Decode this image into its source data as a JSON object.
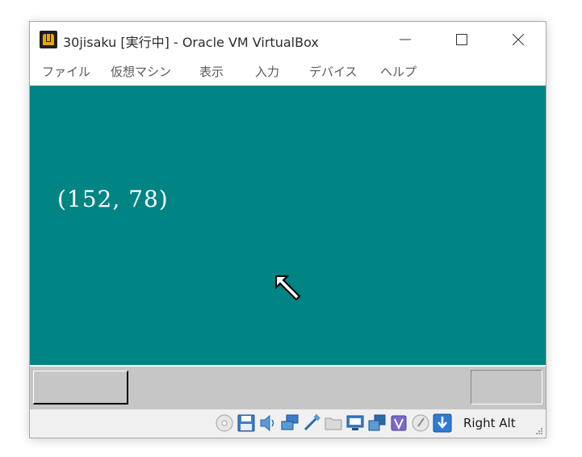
{
  "window": {
    "title": "30jisaku [実行中] - Oracle VM VirtualBox",
    "controls": {
      "minimize_icon": "minimize-icon",
      "maximize_icon": "maximize-icon",
      "close_icon": "close-icon"
    }
  },
  "menubar": {
    "items": [
      {
        "label": "ファイル"
      },
      {
        "label": "仮想マシン"
      },
      {
        "label": "表示"
      },
      {
        "label": "入力"
      },
      {
        "label": "デバイス"
      },
      {
        "label": "ヘルプ"
      }
    ]
  },
  "vm_screen": {
    "background_color": "#008484",
    "coordinates_text": "(152, 78)",
    "cursor_icon": "mouse-arrow-icon"
  },
  "guest_taskbar": {
    "background_color": "#c6c6c6"
  },
  "statusbar": {
    "icons": [
      "optical-drive-icon",
      "floppy-drive-icon",
      "audio-icon",
      "network-icon",
      "usb-icon",
      "shared-folders-icon",
      "display-icon",
      "video-capture-icon",
      "virtualization-icon",
      "mouse-integration-icon",
      "keyboard-capture-icon"
    ],
    "host_key": "Right Alt"
  }
}
